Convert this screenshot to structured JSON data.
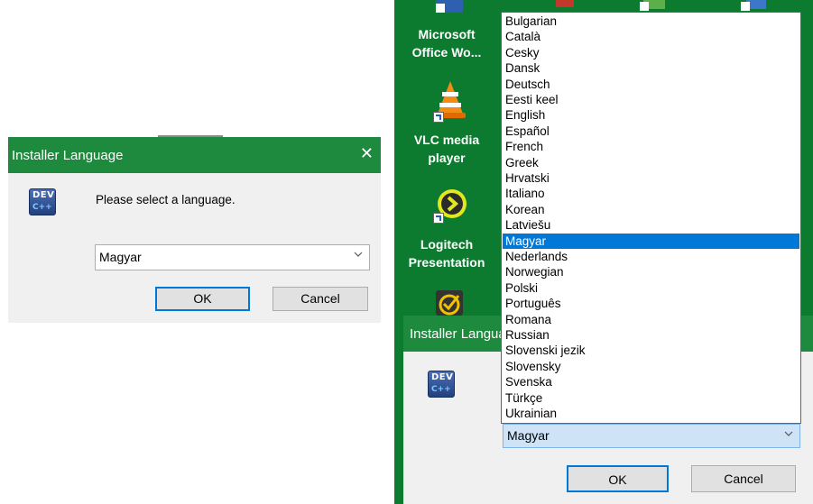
{
  "left_dialog": {
    "title": "Installer Language",
    "close_glyph": "✕",
    "icon": {
      "name": "dev-cpp-icon",
      "text_top": "DEV",
      "text_bottom": "C++"
    },
    "prompt": "Please select a language.",
    "selected_value": "Magyar",
    "ok_label": "OK",
    "cancel_label": "Cancel"
  },
  "desktop": {
    "icons": [
      {
        "name": "microsoft-office-word-icon",
        "label_line1": "Microsoft",
        "label_line2": "Office Wo..."
      },
      {
        "name": "vlc-media-player-icon",
        "label_line1": "VLC media",
        "label_line2": "player"
      },
      {
        "name": "logitech-presentation-icon",
        "label_line1": "Logitech",
        "label_line2": "Presentation"
      },
      {
        "name": "check-shield-icon",
        "label_line1": "",
        "label_line2": ""
      }
    ]
  },
  "right_dialog": {
    "title": "Installer Language",
    "selected_value": "Magyar",
    "ok_label": "OK",
    "cancel_label": "Cancel"
  },
  "language_list": {
    "options": [
      "Bulgarian",
      "Català",
      "Cesky",
      "Dansk",
      "Deutsch",
      "Eesti keel",
      "English",
      "Español",
      "French",
      "Greek",
      "Hrvatski",
      "Italiano",
      "Korean",
      "Latviešu",
      "Magyar",
      "Nederlands",
      "Norwegian",
      "Polski",
      "Português",
      "Romana",
      "Russian",
      "Slovenski jezik",
      "Slovensky",
      "Svenska",
      "Türkçe",
      "Ukrainian"
    ],
    "selected_index": 14
  },
  "colors": {
    "title_bar": "#1e8a3e",
    "desktop": "#0c7a2f",
    "selection": "#0078d7"
  }
}
